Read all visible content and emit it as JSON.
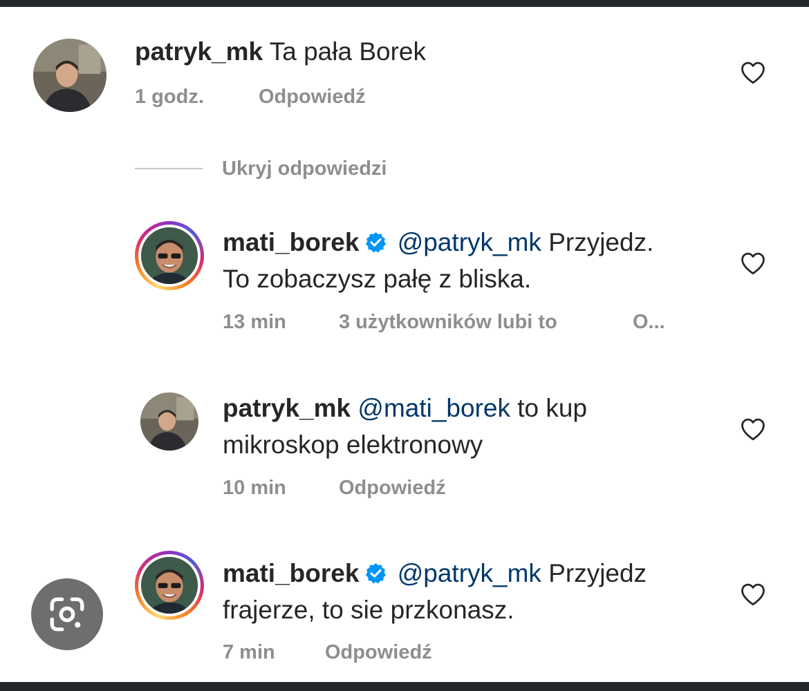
{
  "comments": [
    {
      "username": "patryk_mk",
      "verified": false,
      "mention": "",
      "text": "Ta pała Borek",
      "time": "1 godz.",
      "likes_text": "",
      "reply_label": "Odpowiedź"
    },
    {
      "username": "mati_borek",
      "verified": true,
      "mention": "@patryk_mk",
      "text_line1": "Przyjedz.",
      "text_line2": "To zobaczysz pałę z bliska.",
      "time": "13 min",
      "likes_text": "3 użytkowników lubi to",
      "reply_label": "O..."
    },
    {
      "username": "patryk_mk",
      "verified": false,
      "mention": "@mati_borek",
      "text_line1": "to kup",
      "text_line2": "mikroskop elektronowy",
      "time": "10 min",
      "likes_text": "",
      "reply_label": "Odpowiedź"
    },
    {
      "username": "mati_borek",
      "verified": true,
      "mention": "@patryk_mk",
      "text_line1": "Przyjedz",
      "text_line2": "frajerze, to sie przkonasz.",
      "time": "7 min",
      "likes_text": "",
      "reply_label": "Odpowiedź"
    }
  ],
  "hide_replies_label": "Ukryj odpowiedzi",
  "icons": {
    "like": "heart-outline-icon",
    "verified": "verified-badge-icon",
    "lens": "google-lens-icon"
  },
  "colors": {
    "text": "#262626",
    "meta": "#8e8e8e",
    "mention": "#00376b",
    "verified": "#0095f6",
    "frame": "#23262b"
  }
}
